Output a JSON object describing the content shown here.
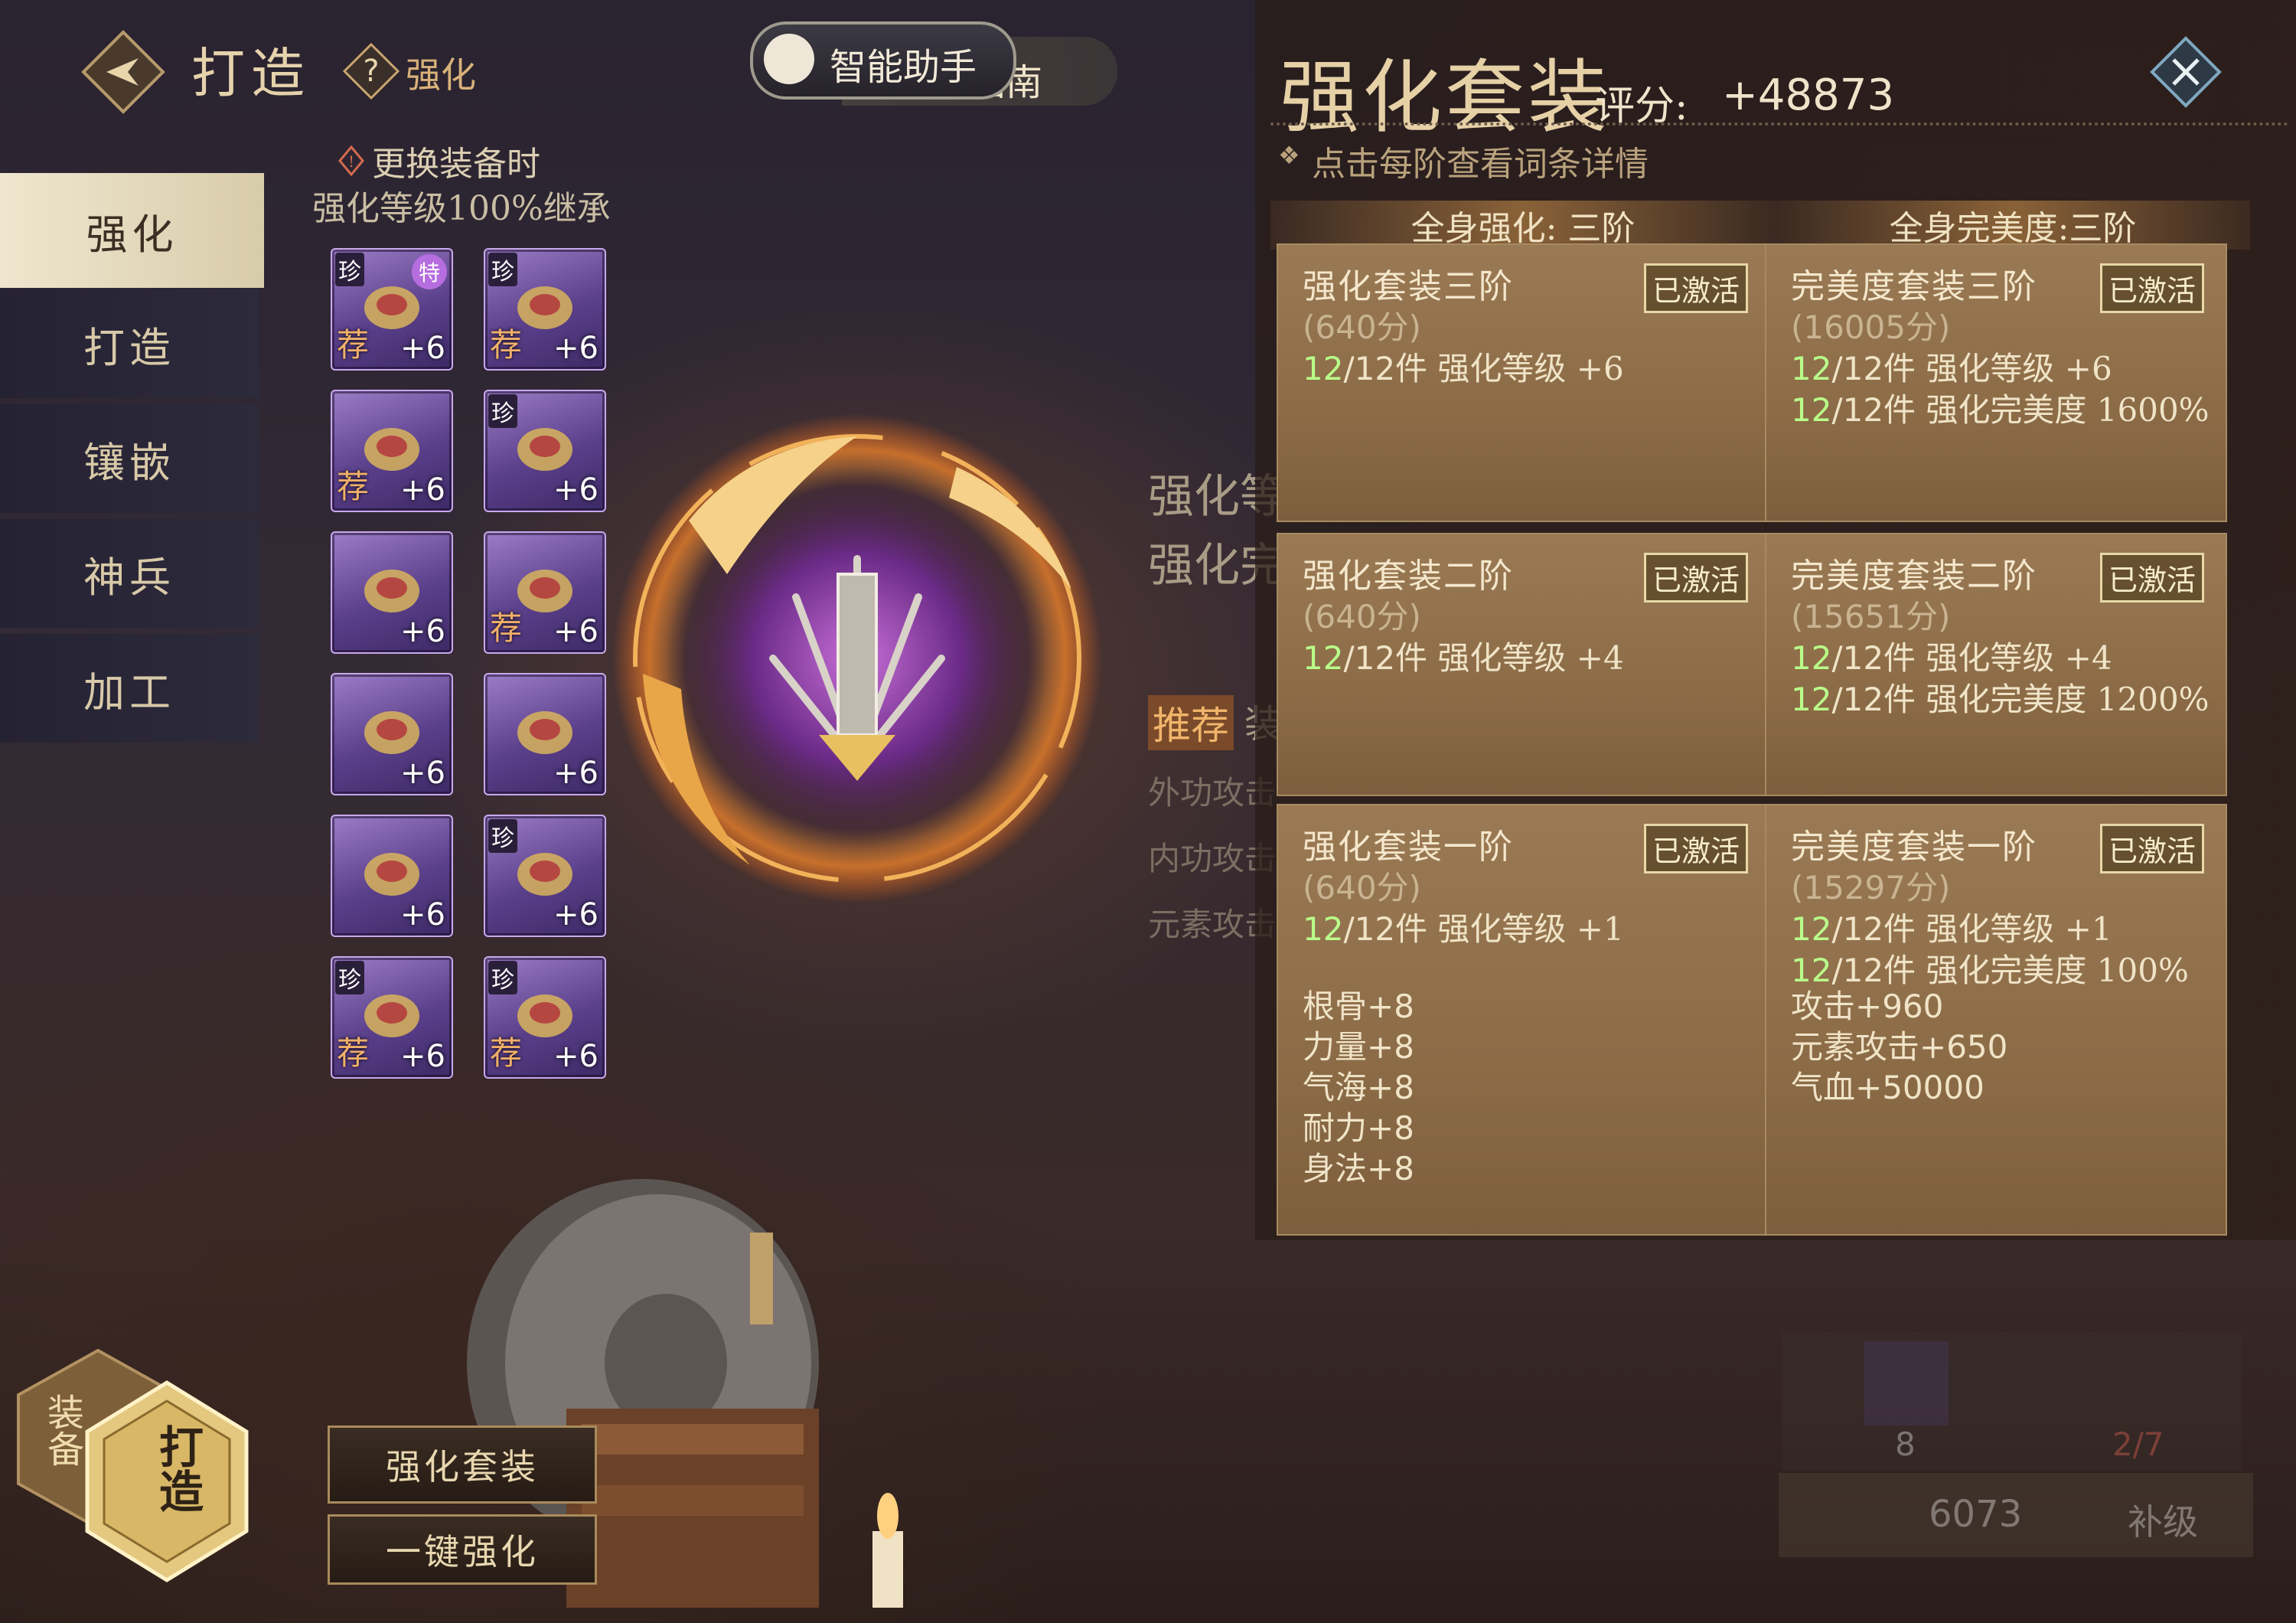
{
  "header": {
    "title": "打造",
    "subtitle": "强化",
    "assistant": "智能助手",
    "guide": "操作指南"
  },
  "side_tabs": [
    "强化",
    "打造",
    "镶嵌",
    "神兵",
    "加工"
  ],
  "inherit_note": {
    "line1": "更换装备时",
    "line2": "强化等级100%继承"
  },
  "equipment": [
    {
      "level": "+6",
      "rare": "珍",
      "recommended": "荐",
      "special": "特"
    },
    {
      "level": "+6",
      "rare": "珍",
      "recommended": "荐"
    },
    {
      "level": "+6",
      "recommended": "荐"
    },
    {
      "level": "+6",
      "rare": "珍"
    },
    {
      "level": "+6"
    },
    {
      "level": "+6",
      "recommended": "荐"
    },
    {
      "level": "+6"
    },
    {
      "level": "+6"
    },
    {
      "level": "+6"
    },
    {
      "level": "+6",
      "rare": "珍"
    },
    {
      "level": "+6",
      "rare": "珍",
      "recommended": "荐"
    },
    {
      "level": "+6",
      "rare": "珍",
      "recommended": "荐"
    }
  ],
  "bottom_buttons": {
    "suit": "强化套装",
    "one_click": "一键强化"
  },
  "hex_tabs": {
    "equip": "装备",
    "forge": "打造"
  },
  "background_labels": {
    "line1": "强化等",
    "line2": "强化完",
    "recommend": "推荐",
    "equip": "装",
    "outer_atk": "外功攻击",
    "inner_atk": "内功攻击",
    "elem_atk": "元素攻击",
    "cost": "6073",
    "count": "8",
    "ratio": "2/7",
    "upgrade": "补级"
  },
  "panel": {
    "title": "强化套装",
    "score_label": "评分:",
    "score": "+48873",
    "hint": "点击每阶查看词条详情",
    "left_header": "全身强化:  三阶",
    "right_header": "全身完美度:三阶",
    "badge": "已激活",
    "left_cards": [
      {
        "title": "强化套装三阶",
        "score": "(640分)",
        "lines": [
          {
            "count": "12",
            "total": "/12件",
            "text": "强化等级 +6"
          }
        ]
      },
      {
        "title": "强化套装二阶",
        "score": "(640分)",
        "lines": [
          {
            "count": "12",
            "total": "/12件",
            "text": "强化等级 +4"
          }
        ]
      },
      {
        "title": "强化套装一阶",
        "score": "(640分)",
        "lines": [
          {
            "count": "12",
            "total": "/12件",
            "text": "强化等级 +1"
          }
        ],
        "attrs": [
          "根骨+8",
          "力量+8",
          "气海+8",
          "耐力+8",
          "身法+8"
        ]
      }
    ],
    "right_cards": [
      {
        "title": "完美度套装三阶",
        "score": "(16005分)",
        "lines": [
          {
            "count": "12",
            "total": "/12件",
            "text": "强化等级 +6"
          },
          {
            "count": "12",
            "total": "/12件",
            "text": "强化完美度 1600%"
          }
        ]
      },
      {
        "title": "完美度套装二阶",
        "score": "(15651分)",
        "lines": [
          {
            "count": "12",
            "total": "/12件",
            "text": "强化等级 +4"
          },
          {
            "count": "12",
            "total": "/12件",
            "text": "强化完美度 1200%"
          }
        ]
      },
      {
        "title": "完美度套装一阶",
        "score": "(15297分)",
        "lines": [
          {
            "count": "12",
            "total": "/12件",
            "text": "强化等级 +1"
          },
          {
            "count": "12",
            "total": "/12件",
            "text": "强化完美度 100%"
          }
        ],
        "attrs": [
          "攻击+960",
          "元素攻击+650",
          "气血+50000"
        ]
      }
    ]
  },
  "colors": {
    "accent_gold": "#e6d0a6",
    "active_green": "#b9ff8a",
    "rare_purple": "#9c7cc6"
  }
}
